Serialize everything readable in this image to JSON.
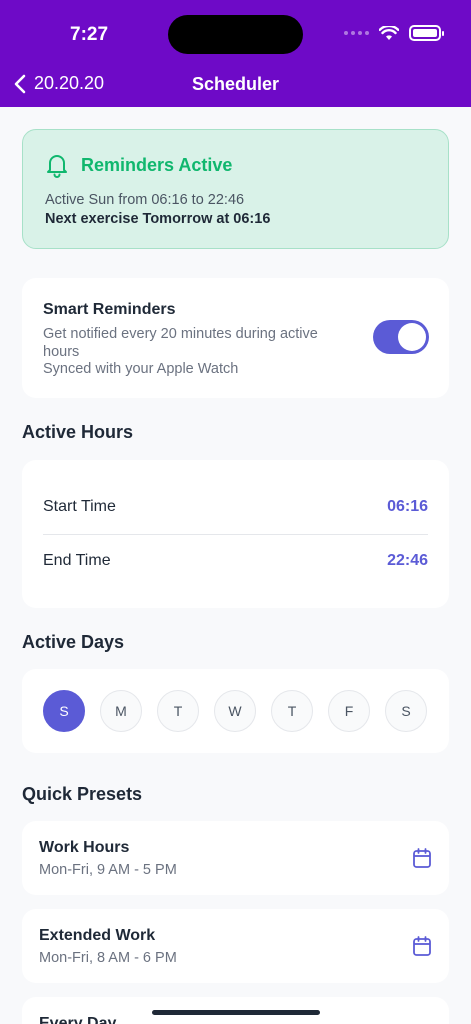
{
  "status_bar": {
    "time": "7:27"
  },
  "nav": {
    "back_label": "20.20.20",
    "title": "Scheduler"
  },
  "banner": {
    "title": "Reminders Active",
    "line1": "Active Sun from 06:16 to 22:46",
    "line2": "Next exercise Tomorrow at 06:16",
    "color": "#10b76e"
  },
  "smart_reminders": {
    "title": "Smart Reminders",
    "description": "Get notified every 20 minutes during active hours",
    "sync": "Synced with your Apple Watch",
    "enabled": true
  },
  "active_hours": {
    "title": "Active Hours",
    "start_label": "Start Time",
    "start_value": "06:16",
    "end_label": "End Time",
    "end_value": "22:46"
  },
  "active_days": {
    "title": "Active Days",
    "days": [
      {
        "label": "S",
        "active": true
      },
      {
        "label": "M",
        "active": false
      },
      {
        "label": "T",
        "active": false
      },
      {
        "label": "W",
        "active": false
      },
      {
        "label": "T",
        "active": false
      },
      {
        "label": "F",
        "active": false
      },
      {
        "label": "S",
        "active": false
      }
    ]
  },
  "quick_presets": {
    "title": "Quick Presets",
    "items": [
      {
        "title": "Work Hours",
        "subtitle": "Mon-Fri, 9 AM - 5 PM",
        "icon": "calendar-icon"
      },
      {
        "title": "Extended Work",
        "subtitle": "Mon-Fri, 8 AM - 6 PM",
        "icon": "calendar-icon"
      },
      {
        "title": "Every Day",
        "subtitle": "",
        "icon": "calendar-icon"
      }
    ]
  },
  "colors": {
    "header": "#6e0ac7",
    "accent": "#5b5bd6",
    "success": "#10b76e"
  }
}
